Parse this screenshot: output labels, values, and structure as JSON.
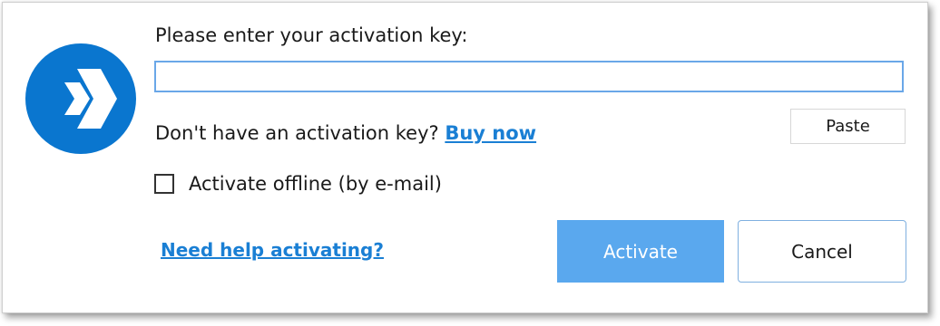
{
  "dialog": {
    "logo_icon": "movavi-logo-icon",
    "prompt_label": "Please enter your activation key:",
    "key_input": {
      "value": "",
      "placeholder": ""
    },
    "no_key_text": "Don't have an activation key?",
    "buy_now_label": "Buy now",
    "paste_label": "Paste",
    "offline_checkbox": {
      "label": "Activate offline (by e-mail)",
      "checked": false
    },
    "help_link_label": "Need help activating?",
    "activate_label": "Activate",
    "cancel_label": "Cancel"
  },
  "colors": {
    "brand_blue": "#0a76cf",
    "link_blue": "#1a7fd4",
    "activate_button_bg": "#5aa8ee",
    "input_border": "#6aa7e8"
  }
}
